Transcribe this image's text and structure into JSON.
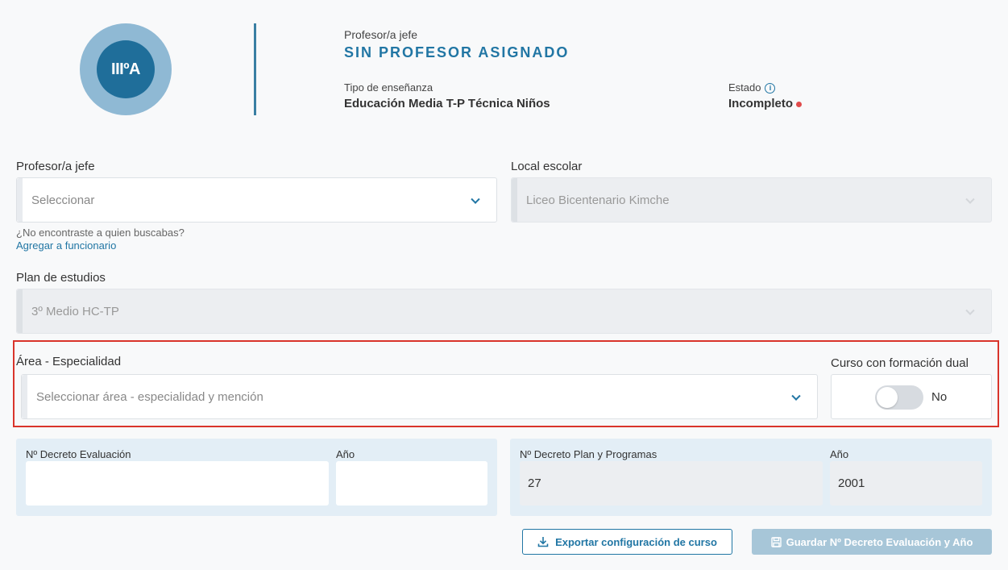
{
  "course": {
    "badge": "IIIºA"
  },
  "header": {
    "teacher_label": "Profesor/a jefe",
    "teacher_value": "SIN PROFESOR ASIGNADO",
    "teaching_type_label": "Tipo de enseñanza",
    "teaching_type_value": "Educación Media T-P Técnica Niños",
    "status_label": "Estado",
    "status_value": "Incompleto"
  },
  "form": {
    "teacher": {
      "label": "Profesor/a jefe",
      "placeholder": "Seleccionar",
      "help": "¿No encontraste a quien buscabas?",
      "link": "Agregar a funcionario"
    },
    "school": {
      "label": "Local escolar",
      "value": "Liceo Bicentenario Kimche"
    },
    "plan": {
      "label": "Plan de estudios",
      "value": "3º Medio HC-TP"
    },
    "area": {
      "label": "Área - Especialidad",
      "placeholder": "Seleccionar área - especialidad y mención"
    },
    "dual": {
      "label": "Curso con formación dual",
      "value": "No",
      "on": false
    }
  },
  "decrees": {
    "evaluation": {
      "label": "Nº Decreto Evaluación",
      "value": "",
      "year_label": "Año",
      "year_value": ""
    },
    "plan": {
      "label": "Nº Decreto Plan y Programas",
      "value": "27",
      "year_label": "Año",
      "year_value": "2001"
    }
  },
  "buttons": {
    "export": "Exportar configuración de curso",
    "save": "Guardar Nº Decreto Evaluación y Año"
  },
  "colors": {
    "accent": "#2176a4",
    "status_incomplete": "#e04b4b",
    "highlight": "#d9342b"
  }
}
